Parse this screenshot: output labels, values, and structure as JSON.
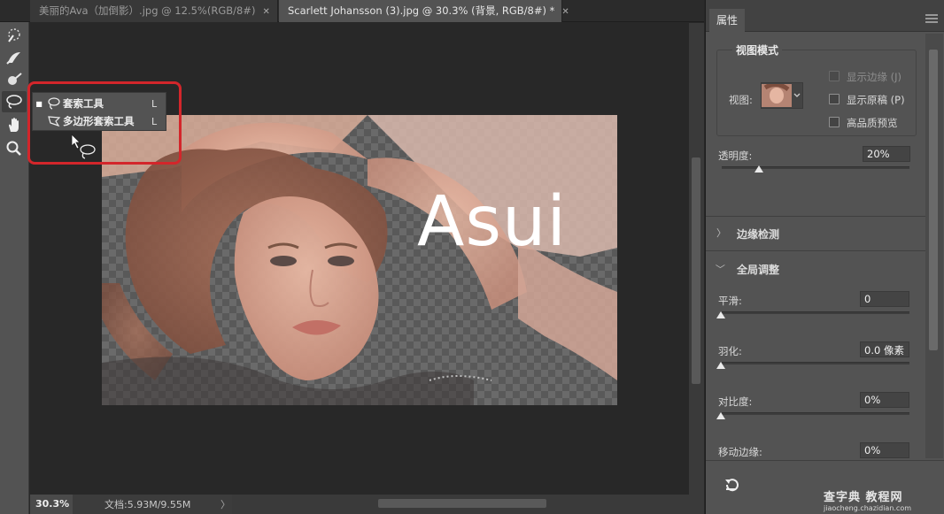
{
  "tabs": [
    {
      "label": "美丽的Ava（加倒影）.jpg @ 12.5%(RGB/8#)",
      "close": "✕"
    },
    {
      "label": "Scarlett Johansson (3).jpg @ 30.3% (背景, RGB/8#) *",
      "close": "✕"
    }
  ],
  "toolbar": {
    "tools": [
      "quick-selection-icon",
      "select-brush-icon",
      "refine-edge-brush-icon",
      "lasso-icon",
      "hand-icon",
      "zoom-icon"
    ]
  },
  "flyout": {
    "items": [
      {
        "label": "套索工具",
        "key": "L",
        "selected": true
      },
      {
        "label": "多边形套索工具",
        "key": "L",
        "selected": false
      }
    ]
  },
  "canvas": {
    "overlay_text": "Asui"
  },
  "status": {
    "zoom": "30.3%",
    "doc": "文档:5.93M/9.55M",
    "arrow": "〉"
  },
  "panel": {
    "tab": "属性",
    "view_mode": {
      "title": "视图模式",
      "view_label": "视图:",
      "show_edge": "显示边缘 (J)",
      "show_original": "显示原稿 (P)",
      "hq_preview": "高品质预览"
    },
    "opacity": {
      "label": "透明度:",
      "value": "20%",
      "level": 0.2
    },
    "edge_detection": {
      "label": "边缘检测"
    },
    "global": {
      "label": "全局调整",
      "smooth": {
        "label": "平滑:",
        "value": "0"
      },
      "feather": {
        "label": "羽化:",
        "value": "0.0 像素"
      },
      "contrast": {
        "label": "对比度:",
        "value": "0%"
      },
      "shift_edge": {
        "label": "移动边缘:",
        "value": "0%"
      }
    },
    "reset_icon": "reset-icon"
  },
  "watermark": {
    "line1": "查字典 教程网",
    "line2": "jiaocheng.chazidian.com"
  },
  "colors": {
    "highlight": "#d3262b",
    "panel_bg": "#535353",
    "canvas_bg": "#282828"
  }
}
